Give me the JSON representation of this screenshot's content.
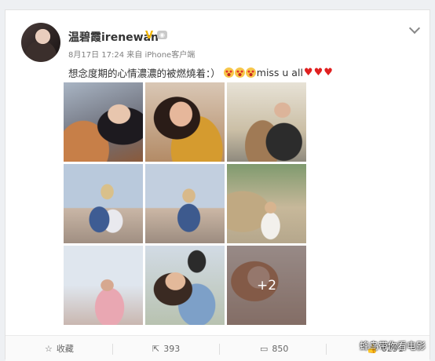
{
  "post": {
    "username": "温碧霞irenewan",
    "verified_mark": "V",
    "meta": "8月17日 17:24 来自 iPhone客户端",
    "text": "想念度期的心情濃濃的被燃燒着：）",
    "text_tail": "miss u all",
    "more_count": "+2"
  },
  "actions": {
    "favorite": "收藏",
    "repost": "393",
    "comment": "850",
    "like": "6291"
  },
  "watermark": "蜂鸟带你看电影",
  "icons": [
    "avatar",
    "verified-icon",
    "robot-badge-icon",
    "chevron-down-icon",
    "star-icon",
    "repost-icon",
    "comment-icon",
    "like-icon"
  ],
  "colors": {
    "accent_gold": "#f0b400",
    "heart": "#e02020",
    "text": "#333333",
    "meta": "#808080"
  }
}
